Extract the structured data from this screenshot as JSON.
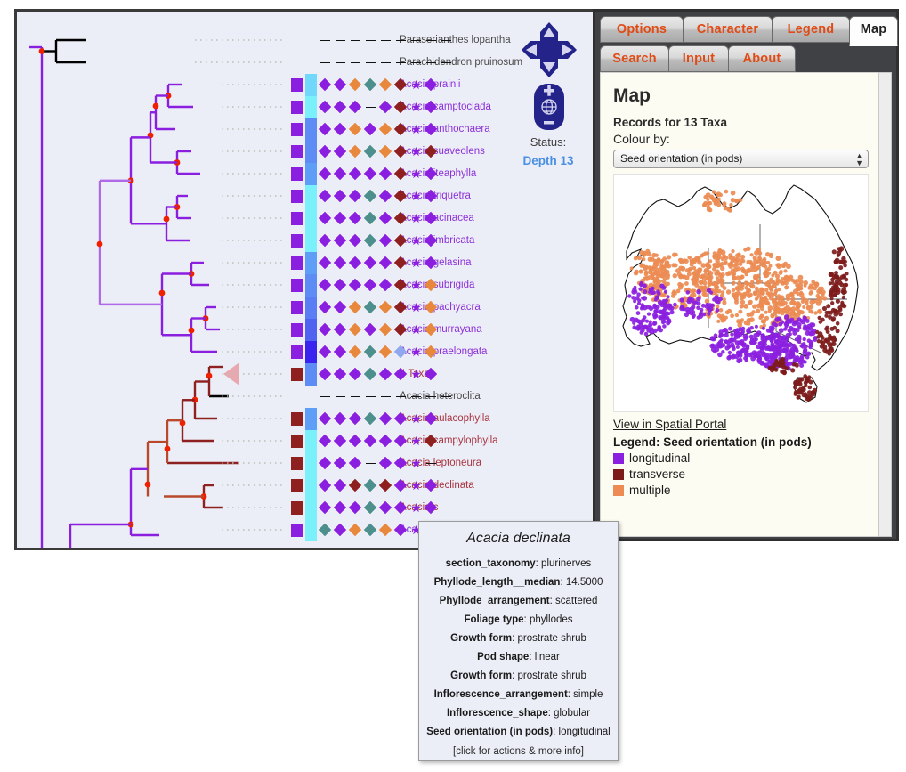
{
  "tree_panel": {
    "status_label": "Status:",
    "status_value": "Depth 13",
    "nav": {
      "up": "nav-up-arrow",
      "down": "nav-down-arrow",
      "left": "nav-left-arrow",
      "right": "nav-right-arrow",
      "zoom_in": "+",
      "zoom_out": "–",
      "globe": "globe-icon"
    },
    "collapsed_clade_label": "4 Taxa",
    "tips": [
      {
        "label": "Paraserianthes lopantha",
        "color": "grey",
        "kind": "dash"
      },
      {
        "label": "Parachidendron pruinosum",
        "color": "grey",
        "kind": "dash"
      },
      {
        "label": "Acacia prainii",
        "color": "violet",
        "kind": "data"
      },
      {
        "label": "Acacia camptoclada",
        "color": "violet",
        "kind": "data"
      },
      {
        "label": "Acacia anthochaera",
        "color": "violet",
        "kind": "data"
      },
      {
        "label": "Acacia suaveolens",
        "color": "violet",
        "kind": "data"
      },
      {
        "label": "Acacia iteaphylla",
        "color": "violet",
        "kind": "data"
      },
      {
        "label": "Acacia triquetra",
        "color": "violet",
        "kind": "data"
      },
      {
        "label": "Acacia acinacea",
        "color": "violet",
        "kind": "data"
      },
      {
        "label": "Acacia imbricata",
        "color": "violet",
        "kind": "data"
      },
      {
        "label": "Acacia gelasina",
        "color": "violet",
        "kind": "data"
      },
      {
        "label": "Acacia subrigida",
        "color": "violet",
        "kind": "data"
      },
      {
        "label": "Acacia pachyacra",
        "color": "violet",
        "kind": "data"
      },
      {
        "label": "Acacia murrayana",
        "color": "violet",
        "kind": "data"
      },
      {
        "label": "Acacia praelongata",
        "color": "violet",
        "kind": "data"
      },
      {
        "label": "4 Taxa",
        "color": "crimson",
        "kind": "data"
      },
      {
        "label": "Acacia heteroclita",
        "color": "grey",
        "kind": "dash"
      },
      {
        "label": "Acacia aulacophylla",
        "color": "crimson",
        "kind": "data"
      },
      {
        "label": "Acacia campylophylla",
        "color": "crimson",
        "kind": "data"
      },
      {
        "label": "Acacia leptoneura",
        "color": "crimson",
        "kind": "data"
      },
      {
        "label": "Acacia declinata",
        "color": "crimson",
        "kind": "data"
      },
      {
        "label": "Acacia c",
        "color": "crimson",
        "kind": "data"
      },
      {
        "label": "Acacia t",
        "color": "violet",
        "kind": "data"
      }
    ],
    "matrix_colors": {
      "violet": "#8b1fe0",
      "orange": "#e8883c",
      "teal": "#4d8f8c",
      "darkred": "#8e2020",
      "lightblue": "#8fa8ee",
      "none": "#111111"
    },
    "matrix_rows": [
      {
        "strip": null,
        "blue": null,
        "cells": [
          "-",
          "-",
          "-",
          "-",
          "-",
          "-",
          "-",
          "-",
          "-"
        ]
      },
      {
        "strip": null,
        "blue": null,
        "cells": [
          "-",
          "-",
          "-",
          "-",
          "-",
          "-",
          "-",
          "-",
          "-"
        ]
      },
      {
        "strip": "#8b1fe0",
        "blue": "#72d8fb",
        "cells": [
          "violet",
          "violet",
          "orange",
          "teal",
          "orange",
          "darkred",
          "star-violet",
          "violet"
        ]
      },
      {
        "strip": "#8b1fe0",
        "blue": "#7af0fb",
        "cells": [
          "violet",
          "violet",
          "violet",
          "-",
          "violet",
          "darkred",
          "star-violet",
          "violet"
        ]
      },
      {
        "strip": "#8b1fe0",
        "blue": "#5e8cf5",
        "cells": [
          "violet",
          "violet",
          "orange",
          "violet",
          "orange",
          "darkred",
          "star-violet",
          "violet"
        ]
      },
      {
        "strip": "#8b1fe0",
        "blue": "#5e8cf5",
        "cells": [
          "violet",
          "violet",
          "orange",
          "teal",
          "orange",
          "darkred",
          "star-violet",
          "darkred"
        ]
      },
      {
        "strip": "#8b1fe0",
        "blue": "#5e9ef7",
        "cells": [
          "violet",
          "violet",
          "violet",
          "violet",
          "violet",
          "darkred",
          "star-violet",
          "violet"
        ]
      },
      {
        "strip": "#8b1fe0",
        "blue": "#7af0fb",
        "cells": [
          "violet",
          "violet",
          "violet",
          "teal",
          "violet",
          "darkred",
          "star-violet",
          "violet"
        ]
      },
      {
        "strip": "#8b1fe0",
        "blue": "#7af0fb",
        "cells": [
          "violet",
          "violet",
          "violet",
          "teal",
          "violet",
          "darkred",
          "star-violet",
          "violet"
        ]
      },
      {
        "strip": "#8b1fe0",
        "blue": "#7af0fb",
        "cells": [
          "violet",
          "violet",
          "violet",
          "teal",
          "violet",
          "darkred",
          "star-violet",
          "violet"
        ]
      },
      {
        "strip": "#8b1fe0",
        "blue": "#5e9ef7",
        "cells": [
          "violet",
          "violet",
          "violet",
          "violet",
          "violet",
          "darkred",
          "star-violet",
          "violet"
        ]
      },
      {
        "strip": "#8b1fe0",
        "blue": "#5e8cf5",
        "cells": [
          "violet",
          "violet",
          "violet",
          "violet",
          "violet",
          "darkred",
          "star-violet",
          "orange"
        ]
      },
      {
        "strip": "#8b1fe0",
        "blue": "#5a7df3",
        "cells": [
          "violet",
          "violet",
          "orange",
          "teal",
          "orange",
          "darkred",
          "star-violet",
          "orange"
        ]
      },
      {
        "strip": "#8b1fe0",
        "blue": "#4f62f0",
        "cells": [
          "violet",
          "violet",
          "orange",
          "violet",
          "orange",
          "darkred",
          "star-violet",
          "orange"
        ]
      },
      {
        "strip": "#8b1fe0",
        "blue": "#3a22ef",
        "cells": [
          "violet",
          "violet",
          "orange",
          "teal",
          "orange",
          "lightblue",
          "star-violet",
          "orange"
        ]
      },
      {
        "strip": "#8e2020",
        "blue": "#5e8cf5",
        "cells": [
          "violet",
          "violet",
          "violet",
          "teal",
          "violet",
          "violet",
          "star-violet",
          "violet"
        ]
      },
      {
        "strip": null,
        "blue": null,
        "cells": [
          "-",
          "-",
          "-",
          "-",
          "-",
          "-",
          "-",
          "-",
          "-"
        ]
      },
      {
        "strip": "#8e2020",
        "blue": "#5e9ef7",
        "cells": [
          "violet",
          "violet",
          "violet",
          "teal",
          "violet",
          "violet",
          "star-violet",
          "violet"
        ]
      },
      {
        "strip": "#8e2020",
        "blue": "#7af0fb",
        "cells": [
          "violet",
          "violet",
          "violet",
          "violet",
          "violet",
          "violet",
          "star-violet",
          "darkred"
        ]
      },
      {
        "strip": "#8e2020",
        "blue": "#7af0fb",
        "cells": [
          "violet",
          "violet",
          "violet",
          "-",
          "violet",
          "violet",
          "star-violet",
          "-"
        ]
      },
      {
        "strip": "#8e2020",
        "blue": "#7af0fb",
        "cells": [
          "violet",
          "violet",
          "darkred",
          "teal",
          "darkred",
          "violet",
          "star-violet",
          "violet"
        ]
      },
      {
        "strip": "#8e2020",
        "blue": "#7af0fb",
        "cells": [
          "violet",
          "violet",
          "violet",
          "teal",
          "violet",
          "violet",
          "star-violet",
          "violet"
        ]
      },
      {
        "strip": "#8b1fe0",
        "blue": "#7af0fb",
        "cells": [
          "teal",
          "violet",
          "orange",
          "teal",
          "orange",
          "violet",
          "star-violet",
          "violet"
        ]
      }
    ]
  },
  "right_panel": {
    "tabs_row1": [
      {
        "label": "Options",
        "active": false
      },
      {
        "label": "Character",
        "active": false
      },
      {
        "label": "Legend",
        "active": false
      },
      {
        "label": "Map",
        "active": true
      }
    ],
    "tabs_row2": [
      {
        "label": "Search",
        "active": false
      },
      {
        "label": "Input",
        "active": false
      },
      {
        "label": "About",
        "active": false
      }
    ],
    "map": {
      "heading": "Map",
      "records_line": "Records for 13 Taxa",
      "colour_by_label": "Colour by:",
      "selected_character": "Seed orientation (in pods)",
      "spatial_portal_link": "View in Spatial Portal",
      "legend_title": "Legend: Seed orientation (in pods)",
      "legend_items": [
        {
          "label": "longitudinal",
          "color": "#8b1fe0"
        },
        {
          "label": "transverse",
          "color": "#7d1b1b"
        },
        {
          "label": "multiple",
          "color": "#ec8b53"
        }
      ]
    }
  },
  "tooltip": {
    "title": "Acacia declinata",
    "rows": [
      {
        "key": "section_taxonomy",
        "value": "plurinerves"
      },
      {
        "key": "Phyllode_length__median",
        "value": "14.5000"
      },
      {
        "key": "Phyllode_arrangement",
        "value": "scattered"
      },
      {
        "key": "Foliage type",
        "value": "phyllodes"
      },
      {
        "key": "Growth form",
        "value": "prostrate shrub"
      },
      {
        "key": "Pod shape",
        "value": "linear"
      },
      {
        "key": "Growth form",
        "value": "prostrate shrub"
      },
      {
        "key": "Inflorescence_arrangement",
        "value": "simple"
      },
      {
        "key": "Inflorescence_shape",
        "value": "globular"
      },
      {
        "key": "Seed orientation (in pods)",
        "value": "longitudinal"
      }
    ],
    "footer": "[click for actions & more info]"
  }
}
